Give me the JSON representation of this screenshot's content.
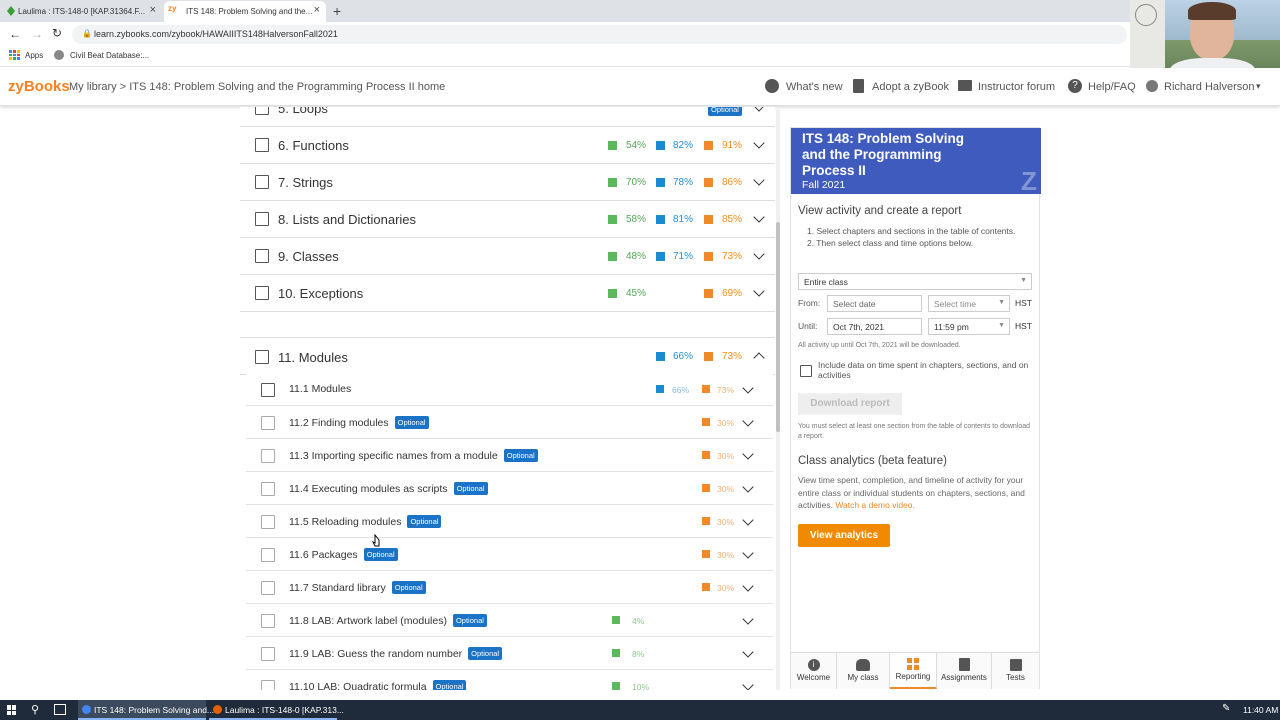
{
  "browser": {
    "tabs": [
      {
        "label": "Laulima : ITS-148-0 [KAP.31364.F...",
        "active": false
      },
      {
        "label": "ITS 148: Problem Solving and the...",
        "active": true
      }
    ],
    "new_tab": "+",
    "url": "learn.zybooks.com/zybook/HAWAIIITS148HalversonFall2021",
    "bookmarks": [
      "Apps",
      "Civil Beat Database:..."
    ]
  },
  "header": {
    "logo": "zyBooks",
    "breadcrumb": "My library > ITS 148: Problem Solving and the Programming Process II home",
    "nav": [
      "What's new",
      "Adopt a zyBook",
      "Instructor forum",
      "Help/FAQ"
    ],
    "user": "Richard Halverson"
  },
  "chapters": [
    {
      "title": "5. Loops",
      "badge": "Optional",
      "green": null,
      "blue": null,
      "orange": null
    },
    {
      "title": "6. Functions",
      "green": "54%",
      "blue": "82%",
      "orange": "91%"
    },
    {
      "title": "7. Strings",
      "green": "70%",
      "blue": "78%",
      "orange": "86%"
    },
    {
      "title": "8. Lists and Dictionaries",
      "green": "58%",
      "blue": "81%",
      "orange": "85%"
    },
    {
      "title": "9. Classes",
      "green": "48%",
      "blue": "71%",
      "orange": "73%"
    },
    {
      "title": "10. Exceptions",
      "green": "45%",
      "blue": null,
      "orange": "69%"
    },
    {
      "title": "11. Modules",
      "green": null,
      "blue": "66%",
      "orange": "73%"
    }
  ],
  "sections": [
    {
      "title": "11.1 Modules",
      "optional": false,
      "blue": "66%",
      "orange": "73%",
      "green": null
    },
    {
      "title": "11.2 Finding modules",
      "optional": true,
      "orange": "30%"
    },
    {
      "title": "11.3 Importing specific names from a module",
      "optional": true,
      "orange": "30%"
    },
    {
      "title": "11.4 Executing modules as scripts",
      "optional": true,
      "orange": "30%"
    },
    {
      "title": "11.5 Reloading modules",
      "optional": true,
      "orange": "30%"
    },
    {
      "title": "11.6 Packages",
      "optional": true,
      "orange": "30%"
    },
    {
      "title": "11.7 Standard library",
      "optional": true,
      "orange": "30%"
    },
    {
      "title": "11.8 LAB: Artwork label (modules)",
      "optional": true,
      "green": "4%"
    },
    {
      "title": "11.9 LAB: Guess the random number",
      "optional": true,
      "green": "8%"
    },
    {
      "title": "11.10 LAB: Quadratic formula",
      "optional": true,
      "green": "10%"
    }
  ],
  "optional_label": "Optional",
  "panel": {
    "title": "ITS 148: Problem Solving and the Programming Process II",
    "term": "Fall 2021",
    "z_mark": "Z",
    "report_heading": "View activity and create a report",
    "steps": [
      "Select chapters and sections in the table of contents.",
      "Then select class and time options below."
    ],
    "class_select": "Entire class",
    "from_label": "From:",
    "from_date": "Select date",
    "from_time": "Select time",
    "until_label": "Until:",
    "until_date": "Oct 7th, 2021",
    "until_time": "11:59 pm",
    "tz": "HST",
    "note": "All activity up until Oct 7th, 2021 will be downloaded.",
    "include_label": "Include data on time spent in chapters, sections, and on activities",
    "download_btn": "Download report",
    "must_select": "You must select at least one section from the table of contents to download a report.",
    "analytics_heading": "Class analytics (beta feature)",
    "analytics_text": "View time spent, completion, and timeline of activity for your entire class or individual students on chapters, sections, and activities.",
    "demo_link": "Watch a demo video.",
    "analytics_btn": "View analytics",
    "tabs": [
      "Welcome",
      "My class",
      "Reporting",
      "Assignments",
      "Tests"
    ],
    "active_tab": "Reporting"
  },
  "taskbar": {
    "items": [
      "ITS 148: Problem Solving and...",
      "Laulima : ITS-148-0 [KAP.313..."
    ],
    "time": "11:40 AM"
  },
  "colors": {
    "green": "#5cb85c",
    "blue": "#1a8bd2",
    "orange": "#f0892a",
    "panel_head": "#3f5bbd",
    "zybooks": "#f5821f"
  }
}
